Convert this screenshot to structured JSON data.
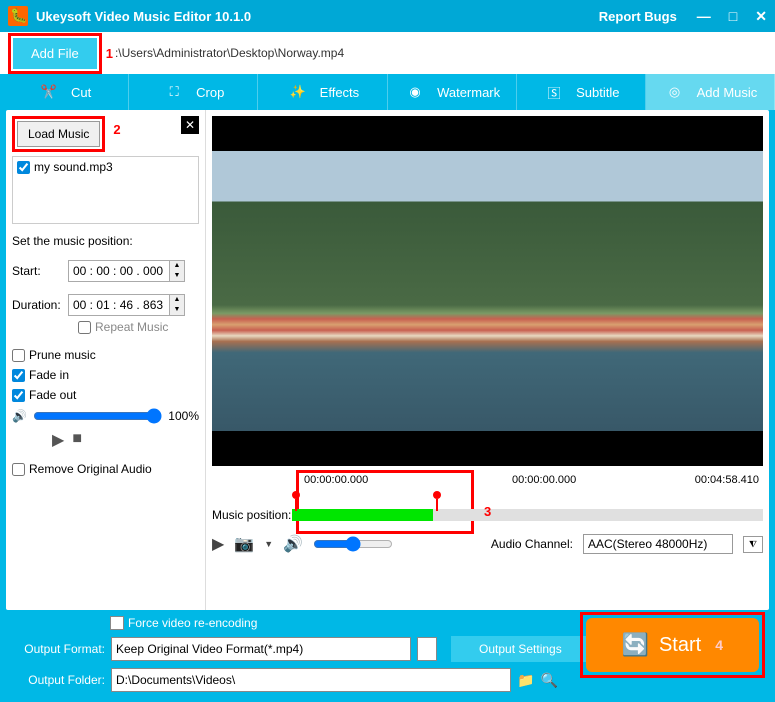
{
  "titlebar": {
    "app_title": "Ukeysoft Video Music Editor 10.1.0",
    "report": "Report Bugs"
  },
  "toolbar": {
    "add_file": "Add File",
    "file_path": ":\\Users\\Administrator\\Desktop\\Norway.mp4"
  },
  "tabs": {
    "cut": "Cut",
    "crop": "Crop",
    "effects": "Effects",
    "watermark": "Watermark",
    "subtitle": "Subtitle",
    "add_music": "Add Music"
  },
  "sidebar": {
    "load_music": "Load Music",
    "music_item": "my sound.mp3",
    "set_position": "Set the music position:",
    "start_label": "Start:",
    "start_value": "00 : 00 : 00 . 000",
    "duration_label": "Duration:",
    "duration_value": "00 : 01 : 46 . 863",
    "repeat": "Repeat Music",
    "prune": "Prune music",
    "fade_in": "Fade in",
    "fade_out": "Fade out",
    "volume_pct": "100%",
    "remove_orig": "Remove Original Audio"
  },
  "preview": {
    "t1": "00:00:00.000",
    "t2": "00:00:00.000",
    "t3": "00:04:58.410",
    "music_pos": "Music position:",
    "audio_channel_label": "Audio Channel:",
    "audio_channel_value": "AAC(Stereo 48000Hz)"
  },
  "bottom": {
    "force": "Force video re-encoding",
    "format_label": "Output Format:",
    "format_value": "Keep Original Video Format(*.mp4)",
    "output_settings": "Output Settings",
    "folder_label": "Output Folder:",
    "folder_value": "D:\\Documents\\Videos\\",
    "start": "Start"
  },
  "annotations": {
    "n1": "1",
    "n2": "2",
    "n3": "3",
    "n4": "4"
  }
}
